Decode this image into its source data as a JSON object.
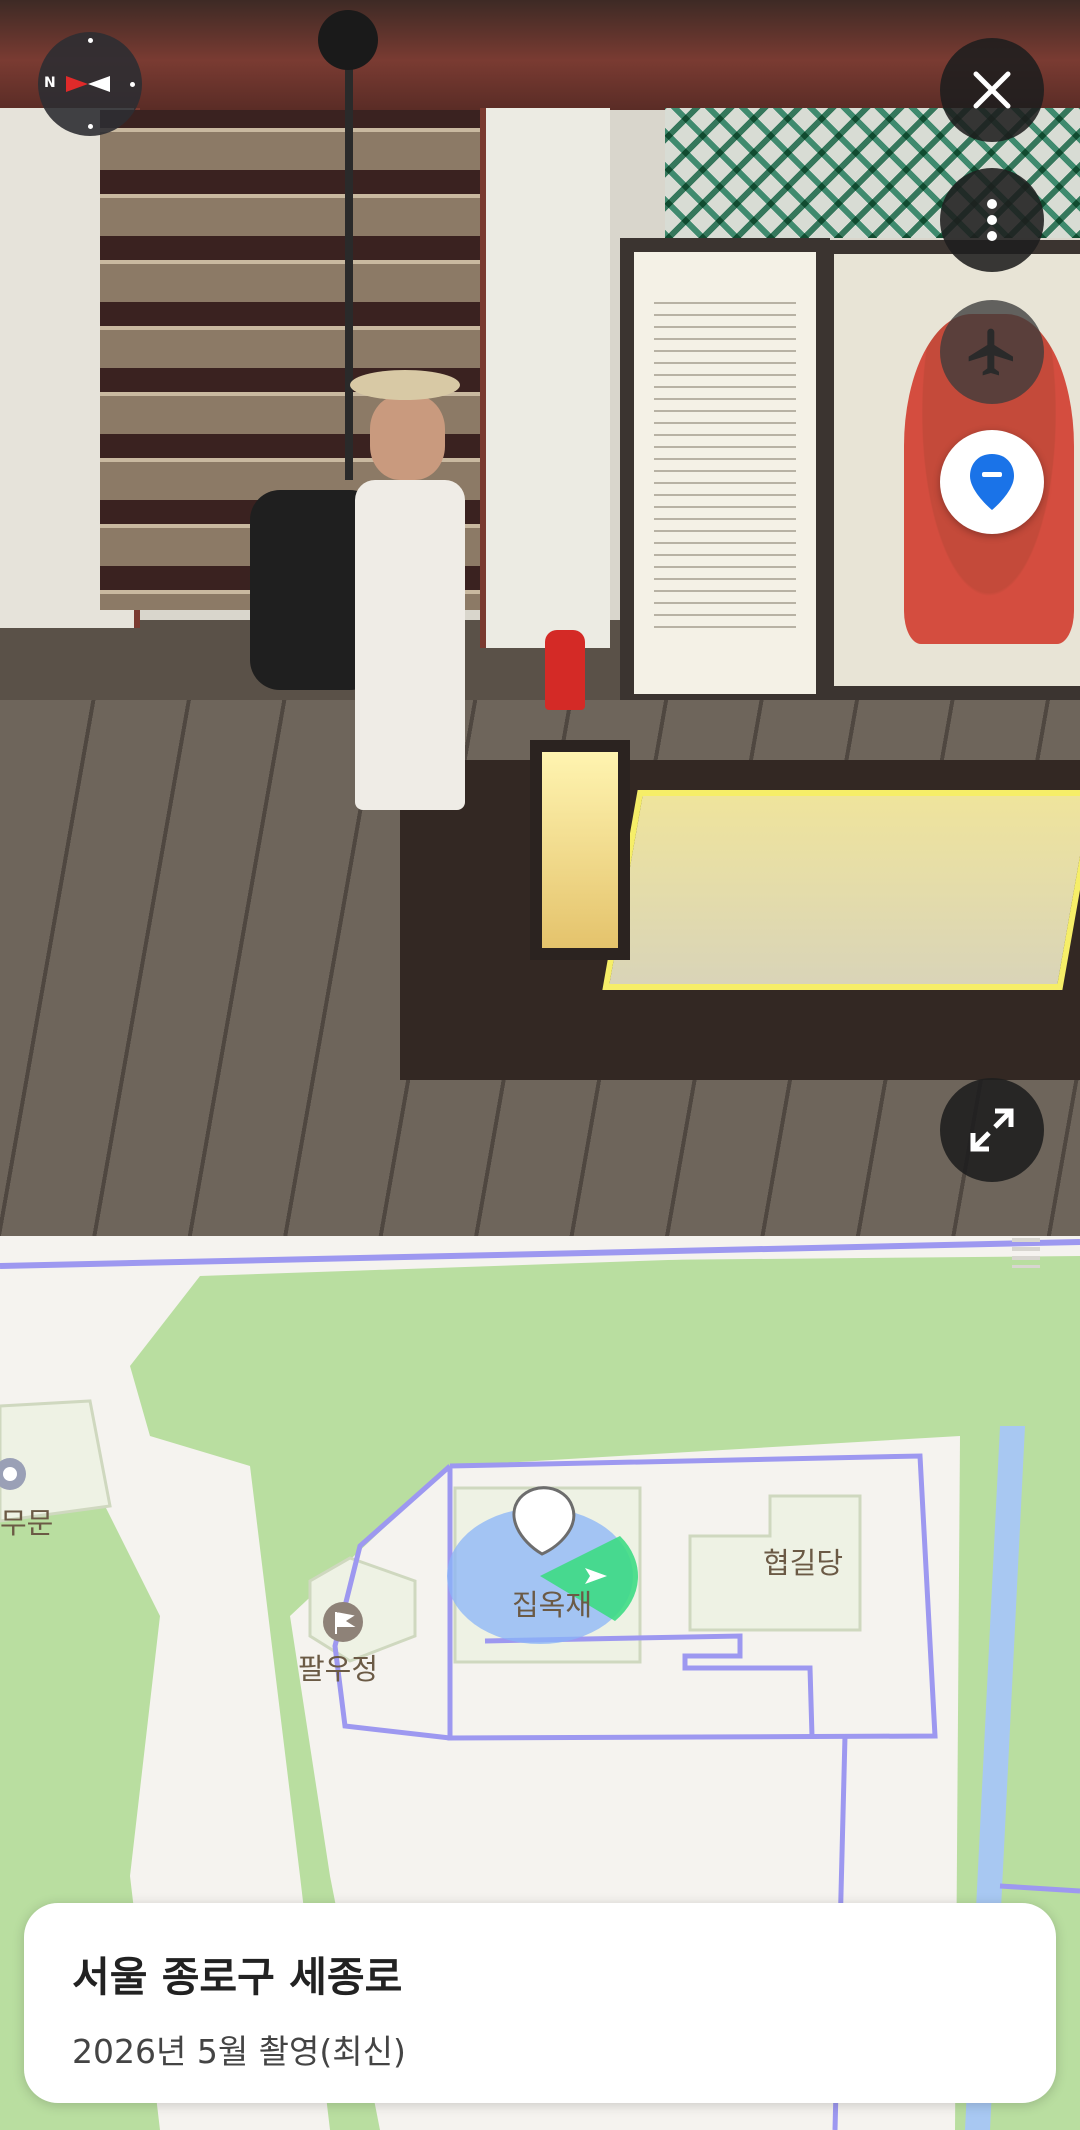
{
  "pano": {
    "compass_letter": "N",
    "buttons": {
      "close_icon": "close-icon",
      "more_icon": "more-vertical-icon",
      "flight_icon": "airplane-icon",
      "location_icon": "location-pin-icon",
      "expand_icon": "expand-icon"
    }
  },
  "map": {
    "labels": {
      "gate_partial": "무문",
      "hyeopgildang": "협길당",
      "jibokjae": "집옥재",
      "palujeong": "팔우정"
    },
    "colors": {
      "green": "#b9dea0",
      "path": "#9d98f0",
      "water": "#a8c8f2",
      "building": "#eef2e4"
    }
  },
  "info": {
    "title": "서울 종로구 세종로",
    "date": "2026년 5월 촬영(최신)"
  }
}
